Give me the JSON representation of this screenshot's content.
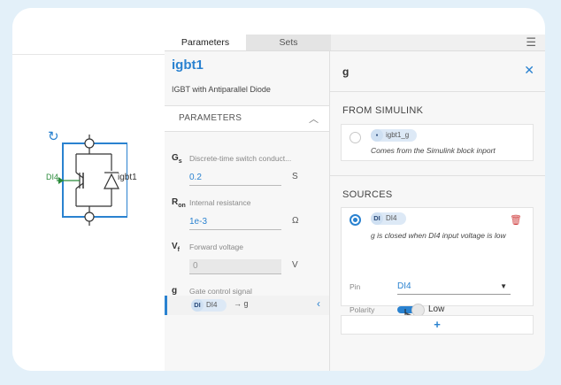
{
  "canvas": {
    "port_label": "DI4",
    "block_name": "igbt1"
  },
  "tabs": [
    {
      "label": "Parameters",
      "active": true
    },
    {
      "label": "Sets",
      "active": false
    }
  ],
  "params_panel": {
    "title": "igbt1",
    "subtitle": "IGBT with Antiparallel Diode",
    "section_label": "PARAMETERS",
    "params": [
      {
        "symbol": "G",
        "sub": "s",
        "desc": "Discrete-time switch conduct...",
        "value": "0.2",
        "unit": "S"
      },
      {
        "symbol": "R",
        "sub": "on",
        "desc": "Internal resistance",
        "value": "1e-3",
        "unit": "Ω"
      },
      {
        "symbol": "V",
        "sub": "f",
        "desc": "Forward voltage",
        "value": "0",
        "unit": "V"
      }
    ],
    "gate": {
      "symbol": "g",
      "desc": "Gate control signal",
      "chip_badge": "DI",
      "chip_label": "DI4",
      "arrow": "→ g"
    }
  },
  "signal_panel": {
    "title": "g",
    "from_simulink": {
      "label": "FROM SIMULINK",
      "chip_label": "igbt1_g",
      "note": "Comes from the Simulink block inport"
    },
    "sources": {
      "label": "SOURCES",
      "chip_badge": "DI",
      "chip_label": "DI4",
      "note": "g is closed when DI4 input voltage is low",
      "pin_label": "Pin",
      "pin_value": "DI4",
      "polarity_label": "Polarity",
      "polarity_value": "Low"
    },
    "add_label": "+"
  },
  "colors": {
    "accent": "#2a82d0",
    "port": "#2a8a3a",
    "delete": "#d04040"
  }
}
